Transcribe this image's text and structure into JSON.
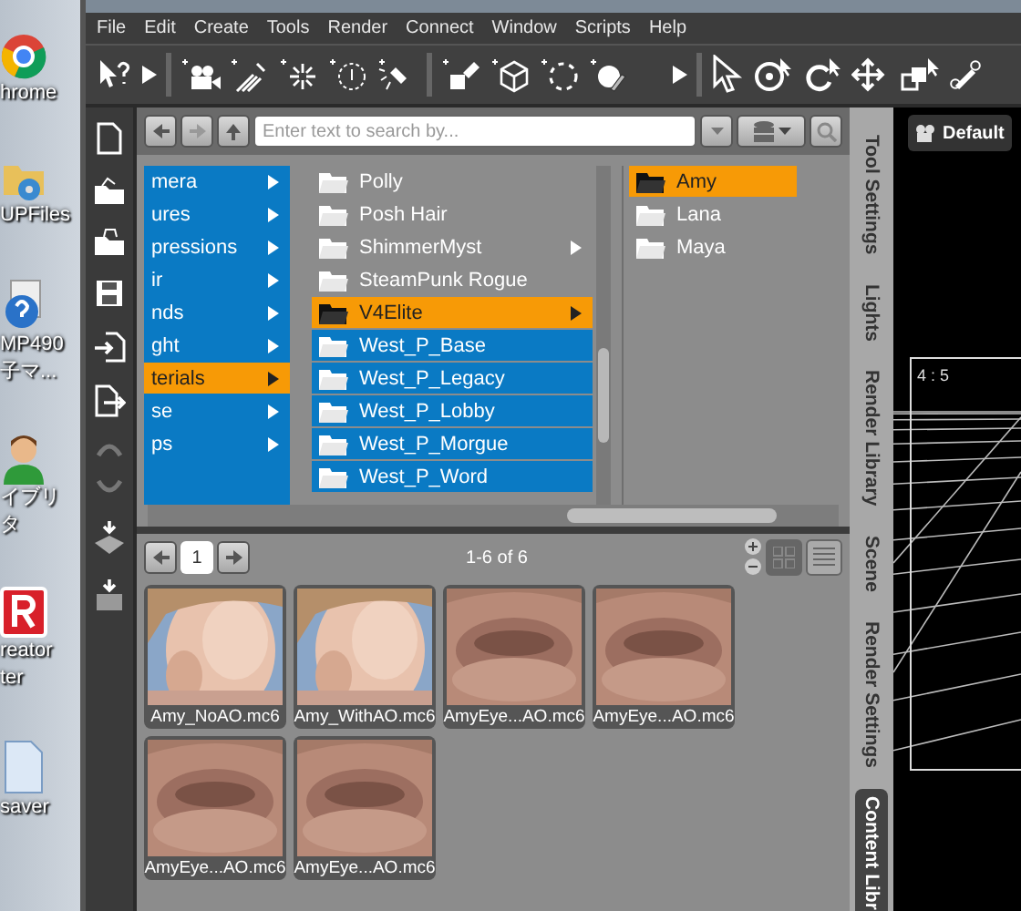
{
  "desktop_icons": [
    {
      "kind": "chrome",
      "lines": [
        "hrome"
      ]
    },
    {
      "kind": "folder",
      "lines": [
        "UPFiles"
      ]
    },
    {
      "kind": "help",
      "lines": [
        "MP490",
        "子マ..."
      ]
    },
    {
      "kind": "person",
      "lines": [
        "イブリ",
        "タ"
      ]
    },
    {
      "kind": "app",
      "lines": [
        "reator",
        "ter"
      ]
    },
    {
      "kind": "document",
      "lines": [
        "saver"
      ]
    }
  ],
  "menu": [
    "File",
    "Edit",
    "Create",
    "Tools",
    "Render",
    "Connect",
    "Window",
    "Scripts",
    "Help"
  ],
  "search": {
    "placeholder": "Enter text to search by..."
  },
  "categories": [
    {
      "label": "mera",
      "selected": false
    },
    {
      "label": "ures",
      "selected": false
    },
    {
      "label": "pressions",
      "selected": false
    },
    {
      "label": "ir",
      "selected": false
    },
    {
      "label": "nds",
      "selected": false
    },
    {
      "label": "ght",
      "selected": false
    },
    {
      "label": "terials",
      "selected": true
    },
    {
      "label": "se",
      "selected": false
    },
    {
      "label": "ps",
      "selected": false
    }
  ],
  "folders": [
    {
      "label": "Polly",
      "selected": false,
      "highlighted": false,
      "has_children": false
    },
    {
      "label": "Posh Hair",
      "selected": false,
      "highlighted": false,
      "has_children": false
    },
    {
      "label": "ShimmerMyst",
      "selected": false,
      "highlighted": false,
      "has_children": true
    },
    {
      "label": "SteamPunk Rogue",
      "selected": false,
      "highlighted": false,
      "has_children": false
    },
    {
      "label": "V4Elite",
      "selected": true,
      "highlighted": false,
      "has_children": true
    },
    {
      "label": "West_P_Base",
      "selected": false,
      "highlighted": true,
      "has_children": false
    },
    {
      "label": "West_P_Legacy",
      "selected": false,
      "highlighted": true,
      "has_children": false
    },
    {
      "label": "West_P_Lobby",
      "selected": false,
      "highlighted": true,
      "has_children": false
    },
    {
      "label": "West_P_Morgue",
      "selected": false,
      "highlighted": true,
      "has_children": false
    },
    {
      "label": "West_P_Word",
      "selected": false,
      "highlighted": true,
      "has_children": false
    }
  ],
  "subfolders": [
    {
      "label": "Amy",
      "selected": true
    },
    {
      "label": "Lana",
      "selected": false
    },
    {
      "label": "Maya",
      "selected": false
    }
  ],
  "pager": {
    "page": "1",
    "range": "1-6 of 6"
  },
  "view_buttons": [
    {
      "kind": "grid",
      "selected": true
    },
    {
      "kind": "list",
      "selected": false
    }
  ],
  "thumbnails": [
    {
      "label": "Amy_NoAO.mc6",
      "kind": "picture"
    },
    {
      "label": "Amy_WithAO.mc6",
      "kind": "picture"
    },
    {
      "label": "AmyEye...AO.mc6",
      "kind": "picture"
    },
    {
      "label": "AmyEye...AO.mc6",
      "kind": "picture"
    },
    {
      "label": "AmyEye...AO.mc6",
      "kind": "picture"
    },
    {
      "label": "AmyEye...AO.mc6",
      "kind": "picture"
    }
  ],
  "side_tabs": [
    {
      "label": "Tool Settings",
      "selected": false
    },
    {
      "label": "Lights",
      "selected": false
    },
    {
      "label": "Render Library",
      "selected": false
    },
    {
      "label": "Scene",
      "selected": false
    },
    {
      "label": "Render Settings",
      "selected": false
    },
    {
      "label": "Content Libr",
      "selected": true
    }
  ],
  "viewport": {
    "camera": "Default",
    "aspect": "4 : 5"
  }
}
